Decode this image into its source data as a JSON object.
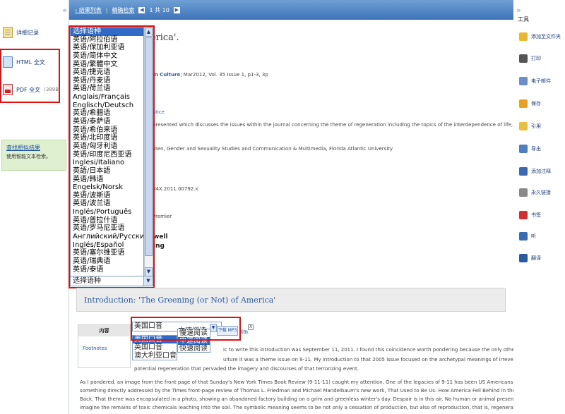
{
  "left": {
    "collapse": "«",
    "items": [
      {
        "label": "详细记录",
        "icon": "document-icon"
      },
      {
        "label": "HTML 全文",
        "icon": "html-icon"
      },
      {
        "label": "PDF 全文",
        "size": "(389B)",
        "icon": "pdf-icon"
      }
    ],
    "find_similar": {
      "link": "查找相似结果",
      "desc": "使用智能文本检索。"
    }
  },
  "topbar": {
    "results_link": "‹ 结果列表",
    "refine_link": "精确检索",
    "counter": "1 共 10"
  },
  "article": {
    "title_fragment": "g (or Not) of America'.",
    "source_fragment": "rican Culture",
    "source_rest": "; Mar2012, Vol. 35 Issue 1, p1-3, 3p",
    "line_y": "y",
    "line_justice": "L justice",
    "abstract_fragment": "presented which discusses the issues within the journal concerning the theme of regeneration including the topics of the interdependence of life, environmental justice and",
    "affil_fragment": "men, Gender and Sexuality Studies and Communication & Multimedia, Florida Atlantic University",
    "doi_fragment": "34X.2011.00792.x",
    "db_fragment": "Premier",
    "bold1": "well",
    "bold2": "ing"
  },
  "lang_dropdown": {
    "options": [
      "选择语种",
      "英语/阿拉伯语",
      "英语/保加利亚语",
      "英语/简体中文",
      "英语/繁體中文",
      "英语/捷克语",
      "英语/丹麦语",
      "英语/荷兰语",
      "Anglais/Français",
      "Englisch/Deutsch",
      "英语/希腊语",
      "英语/泰萨语",
      "英语/希伯来语",
      "英语/北印度语",
      "英语/匈牙利语",
      "英语/印度尼西亚语",
      "Inglesi/Italiano",
      "英語/日本語",
      "英语/韩语",
      "Engelsk/Norsk",
      "英语/波斯语",
      "英语/波兰语",
      "Inglés/Português",
      "英语/普拉什语",
      "英语/罗马尼亚语",
      "Английский/Русский",
      "Inglés/Español",
      "英语/塞尔维亚语",
      "英语/瑞典语",
      "英语/泰语"
    ],
    "highlighted": 0,
    "selected": "选择语种"
  },
  "intro": {
    "heading": "Introduction: 'The Greening (or Not) of America'",
    "toc_header": "内容",
    "toc_link": "Footnotes"
  },
  "tts": {
    "voice": "美国口音",
    "speed": "中速阅读",
    "voice_options": [
      "美国口音",
      "英国口音",
      "澳大利亚口音"
    ],
    "voice_highlighted": 0,
    "speed_options": [
      "慢速阅读",
      "中速阅读",
      "快速阅读"
    ],
    "speed_highlighted": 1,
    "download": "下载 MP3",
    "help": "帮助",
    "close": "X"
  },
  "body_lines": [
    "ic to write this introduction was September 11, 2011. I found this coincidence worth pondering because the only other time I had guest-edited a",
    "ulture it was a theme issue on 9-11. My Introduction to that 2005 issue focused on the archetypal meanings of irreversible destruction as well as",
    "potential regeneration that pervaded the imagery and discourses of that terrorizing event.",
    "As I pondered, an image from the front page of that Sunday's New York Times Book Review (9-11-11) caught my attention. One of the legacies of 9-11 has been US Americans' collective apprehension of national demise,",
    "something directly addressed by the Times front-page review of Thomas L. Friedman and Michael Mandelbaum's new work, That Used to Be Us: How America Fell Behind in the World It Invented and How We Can Come",
    "Back. That theme was encapsulated in a photo, showing an abandoned factory building on a grim and greenless winter's day. Despair is in this air. No human or animal presence can be detected and viewers easily might",
    "imagine the remains of toxic chemicals leaching into the soil. The symbolic meaning seems to be not only a cessation of production, but also of reproduction, that is, regeneration. Winter has come1 and, the photo seems to"
  ],
  "tools": {
    "collapse": "»",
    "header": "工具",
    "items": [
      {
        "label": "添加至文件夹",
        "icon": "folder-add-icon",
        "color": "#e8b830"
      },
      {
        "label": "打印",
        "icon": "printer-icon",
        "color": "#555555"
      },
      {
        "label": "电子邮件",
        "icon": "email-icon",
        "color": "#6a8fc8"
      },
      {
        "label": "保存",
        "icon": "save-icon",
        "color": "#e8a020"
      },
      {
        "label": "引用",
        "icon": "cite-icon",
        "color": "#e8c040"
      },
      {
        "label": "导出",
        "icon": "export-icon",
        "color": "#4d80c0"
      },
      {
        "label": "添加注释",
        "icon": "note-icon",
        "color": "#3a6ab0"
      },
      {
        "label": "永久链接",
        "icon": "permalink-icon",
        "color": "#888888"
      },
      {
        "label": "书签",
        "icon": "bookmark-icon",
        "color": "#d03030"
      },
      {
        "label": "听",
        "icon": "listen-icon",
        "color": "#3a6ab0"
      },
      {
        "label": "翻译",
        "icon": "translate-icon",
        "color": "#2a5aa0"
      }
    ]
  }
}
